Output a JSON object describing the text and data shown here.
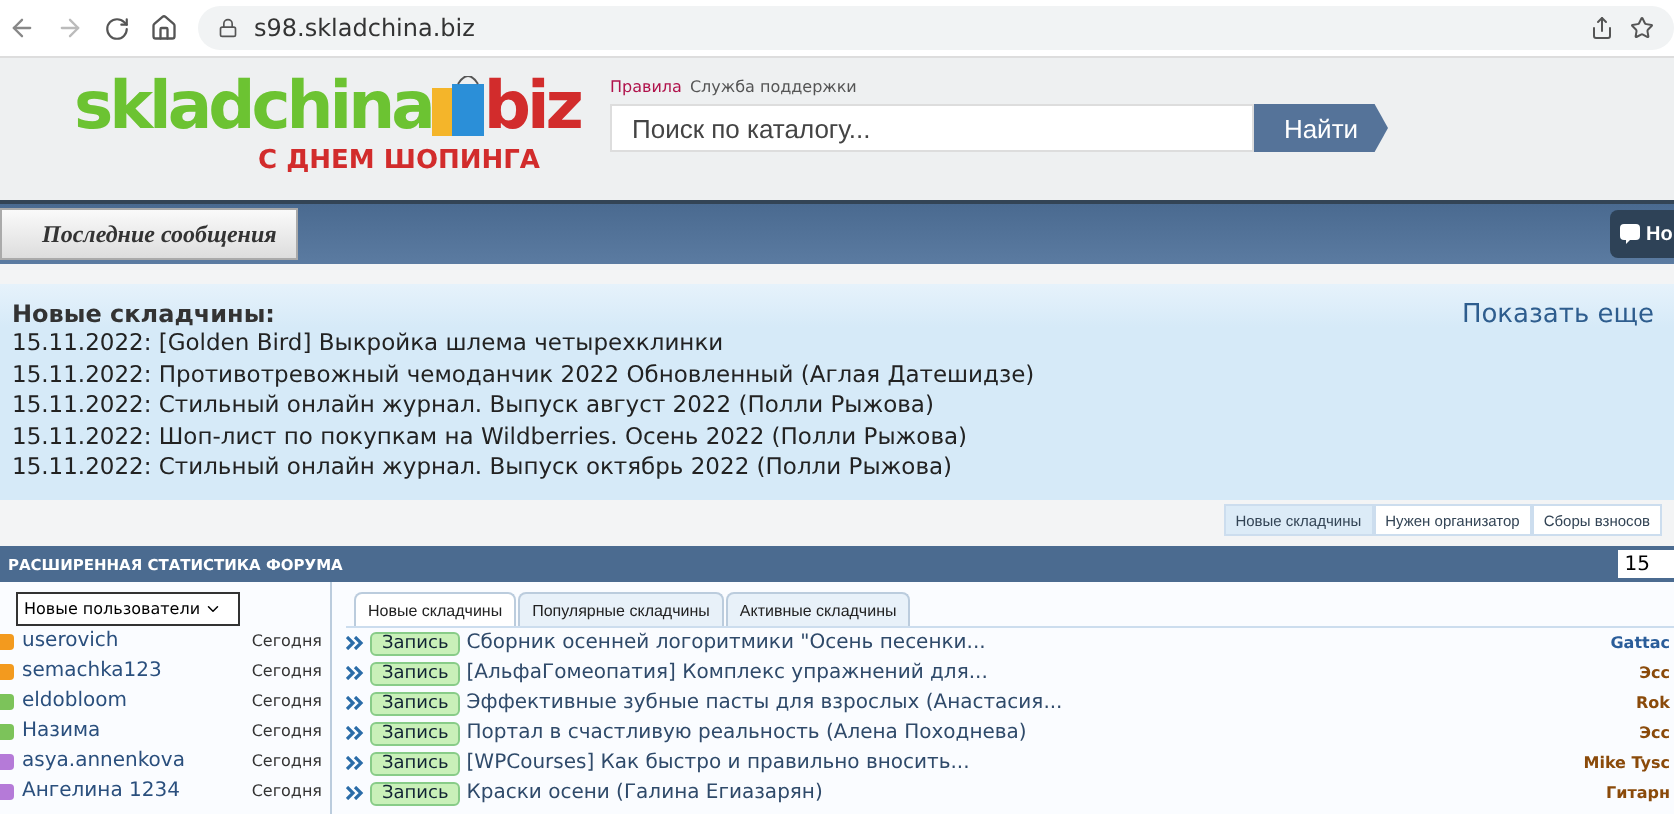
{
  "browser": {
    "url": "s98.skladchina.biz"
  },
  "logo": {
    "name": "skladchina",
    "suffix": "biz",
    "slogan": "С ДНЕМ ШОПИНГА"
  },
  "header_links": [
    "Правила",
    "Служба поддержки"
  ],
  "search": {
    "placeholder": "Поиск по каталогу...",
    "button": "Найти"
  },
  "nav": {
    "items": [
      "Последние сообщения"
    ],
    "right_button": "Но"
  },
  "news": {
    "title": "Новые складчины:",
    "more": "Показать еще",
    "items": [
      "15.11.2022: [Golden Bird] Выкройка шлема четырехклинки",
      "15.11.2022: Противотревожный чемоданчик 2022 Обновленный (Аглая Датешидзе)",
      "15.11.2022: Стильный онлайн журнал. Выпуск август 2022 (Полли Рыжова)",
      "15.11.2022: Шоп-лист по покупкам на Wildberries. Осень 2022 (Полли Рыжова)",
      "15.11.2022: Стильный онлайн журнал. Выпуск октябрь 2022 (Полли Рыжова)"
    ]
  },
  "news_tabs": [
    {
      "label": "Новые складчины",
      "selected": true
    },
    {
      "label": "Нужен организатор",
      "selected": false
    },
    {
      "label": "Сборы взносов",
      "selected": false
    }
  ],
  "stats": {
    "title": "РАСШИРЕННАЯ СТАТИСТИКА ФОРУМА",
    "count": "15",
    "users_select": "Новые пользователи",
    "users": [
      {
        "name": "userovich",
        "when": "Сегодня",
        "color": "#f39a1e"
      },
      {
        "name": "semachka123",
        "when": "Сегодня",
        "color": "#f39a1e"
      },
      {
        "name": "eldobloom",
        "when": "Сегодня",
        "color": "#7cc35a"
      },
      {
        "name": "Назима",
        "when": "Сегодня",
        "color": "#7cc35a"
      },
      {
        "name": "asya.annenkova",
        "when": "Сегодня",
        "color": "#b57ad8"
      },
      {
        "name": "Ангелина 1234",
        "when": "Сегодня",
        "color": "#b57ad8"
      }
    ],
    "tabs": [
      {
        "label": "Новые складчины",
        "selected": true
      },
      {
        "label": "Популярные складчины",
        "selected": false
      },
      {
        "label": "Активные складчины",
        "selected": false
      }
    ],
    "threads": [
      {
        "badge": "Запись",
        "title": "Сборник осенней логоритмики \"Осень песенки...",
        "author": "Gattac",
        "color": "#2a5d9a"
      },
      {
        "badge": "Запись",
        "title": "[АльфаГомеопатия] Комплекс упражнений для...",
        "author": "Эсс",
        "color": "#8a4a0a"
      },
      {
        "badge": "Запись",
        "title": "Эффективные зубные пасты для взрослых (Анастасия...",
        "author": "Rok",
        "color": "#8a4a0a"
      },
      {
        "badge": "Запись",
        "title": "Портал в счастливую реальность (Алена Походнева)",
        "author": "Эсс",
        "color": "#8a4a0a"
      },
      {
        "badge": "Запись",
        "title": "[WPCourses] Как быстро и правильно вносить...",
        "author": "Mike Tysc",
        "color": "#8a4a0a"
      },
      {
        "badge": "Запись",
        "title": "Краски осени (Галина Егиазарян)",
        "author": "Гитарн",
        "color": "#8a4a0a"
      }
    ]
  }
}
